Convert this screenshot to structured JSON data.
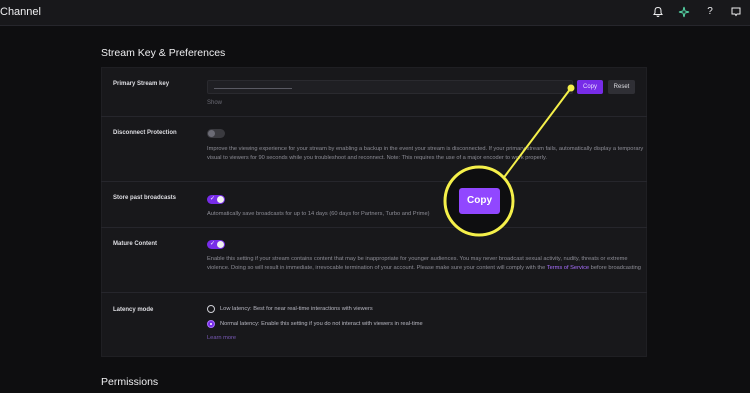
{
  "header": {
    "title": "Channel",
    "icons": [
      "bell-icon",
      "sparkle-icon",
      "help-icon",
      "inbox-icon"
    ]
  },
  "main": {
    "section_title": "Stream Key & Preferences",
    "permissions_title": "Permissions"
  },
  "stream_key": {
    "label": "Primary Stream key",
    "copy_label": "Copy",
    "reset_label": "Reset",
    "show_label": "Show"
  },
  "disconnect": {
    "label": "Disconnect Protection",
    "enabled": false,
    "description": "Improve the viewing experience for your stream by enabling a backup in the event your stream is disconnected. If your primary stream fails, automatically display a temporary visual to viewers for 90 seconds while you troubleshoot and reconnect. Note: This requires the use of a major encoder to work properly."
  },
  "past_broadcasts": {
    "label": "Store past broadcasts",
    "enabled": true,
    "description": "Automatically save broadcasts for up to 14 days (60 days for Partners, Turbo and Prime)"
  },
  "mature": {
    "label": "Mature Content",
    "enabled": true,
    "description_before": "Enable this setting if your stream contains content that may be inappropriate for younger audiences. You may never broadcast sexual activity, nudity, threats or extreme violence. Doing so will result in immediate, irrevocable termination of your account. Please make sure your content will comply with the ",
    "terms_link": "Terms of Service",
    "description_after": " before broadcasting"
  },
  "latency": {
    "label": "Latency mode",
    "options": [
      {
        "label": "Low latency: Best for near real-time interactions with viewers",
        "selected": false
      },
      {
        "label": "Normal latency: Enable this setting if you do not interact with viewers in real-time",
        "selected": true
      }
    ],
    "learn_more": "Learn more"
  },
  "callout": {
    "label": "Copy",
    "color": "#f5f04a"
  },
  "colors": {
    "accent": "#772ce8",
    "background": "#0e0e10",
    "panel": "#18181b"
  }
}
